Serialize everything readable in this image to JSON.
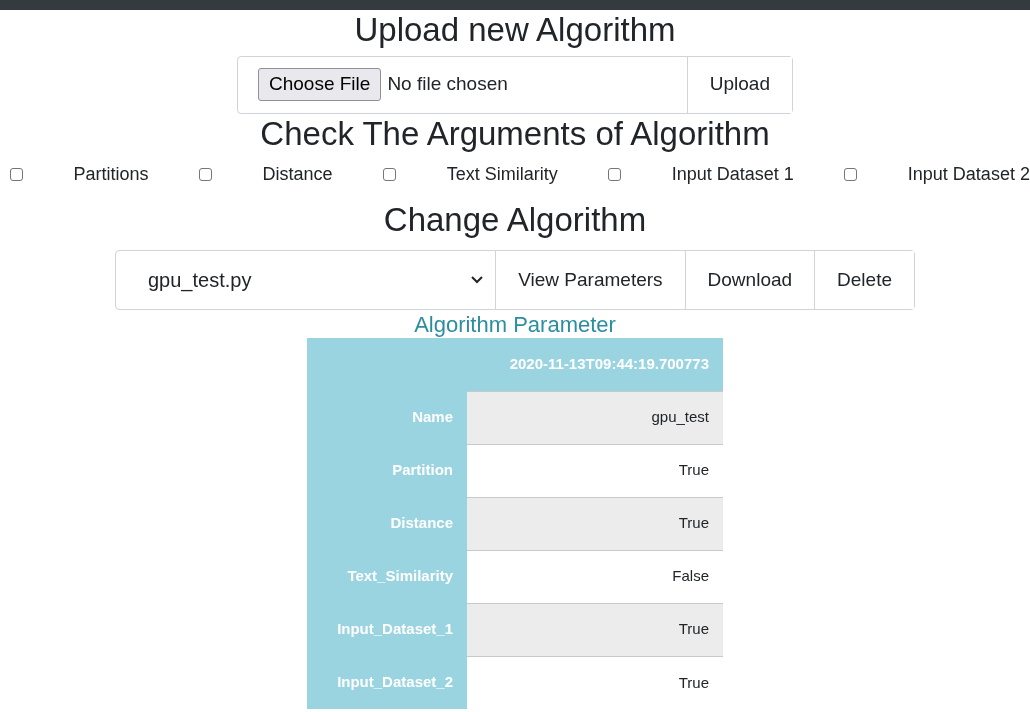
{
  "upload": {
    "title": "Upload new Algorithm",
    "file_button": "Choose File",
    "file_status": "No file chosen",
    "submit": "Upload"
  },
  "arguments": {
    "title": "Check The Arguments of Algorithm",
    "items": [
      {
        "label": "Partitions",
        "checked": false
      },
      {
        "label": "Distance",
        "checked": false
      },
      {
        "label": "Text Similarity",
        "checked": false
      },
      {
        "label": "Input Dataset 1",
        "checked": false
      },
      {
        "label": "Input Dataset 2",
        "checked": false
      }
    ]
  },
  "change": {
    "title": "Change Algorithm",
    "selected_file": "gpu_test.py",
    "buttons": [
      "View Parameters",
      "Download",
      "Delete"
    ]
  },
  "parameters": {
    "title": "Algorithm Parameter",
    "header": "2020-11-13T09:44:19.700773",
    "rows": [
      {
        "key": "Name",
        "value": "gpu_test"
      },
      {
        "key": "Partition",
        "value": "True"
      },
      {
        "key": "Distance",
        "value": "True"
      },
      {
        "key": "Text_Similarity",
        "value": "False"
      },
      {
        "key": "Input_Dataset_1",
        "value": "True"
      },
      {
        "key": "Input_Dataset_2",
        "value": "True"
      }
    ]
  }
}
